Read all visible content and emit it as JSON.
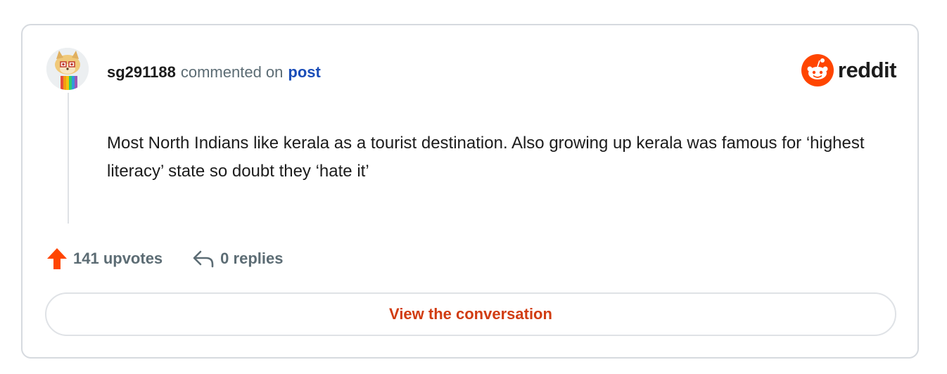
{
  "comment": {
    "username": "sg291188",
    "action": "commented on",
    "link_label": "post",
    "body": "Most North Indians like kerala as a tourist destination. Also growing up kerala was famous for ‘highest literacy’ state so doubt they ‘hate it’",
    "upvotes": "141 upvotes",
    "replies": "0 replies"
  },
  "brand": {
    "name": "reddit",
    "color": "#ff4500"
  },
  "cta": {
    "label": "View the conversation",
    "color": "#d13c11"
  },
  "icons": {
    "avatar": "snoo-doge-avatar",
    "upvote": "upvote-arrow-icon",
    "reply": "reply-arrow-icon",
    "brand": "reddit-snoo-logo"
  }
}
